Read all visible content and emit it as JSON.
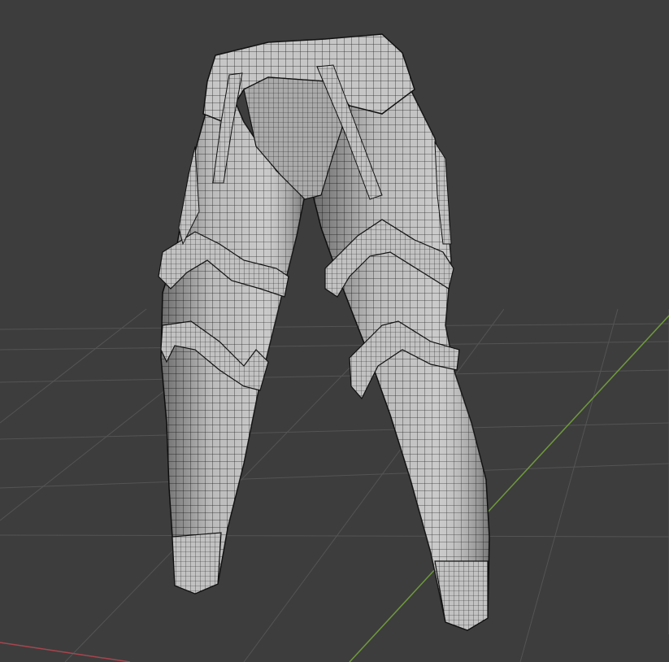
{
  "viewport": {
    "editor": "3D Viewport",
    "shading": "solid-wireframe",
    "background_color": "#3d3d3d",
    "grid_color": "#545454",
    "x_axis_color": "#a8454e",
    "y_axis_color": "#6f9a3c",
    "mesh_color": "#c8c8c8",
    "wire_color": "#1e1e1e"
  },
  "scene": {
    "object": "pants-mesh",
    "parts": [
      "waistband",
      "left-leg",
      "right-leg",
      "thigh-straps",
      "knee-straps",
      "crotch"
    ]
  }
}
